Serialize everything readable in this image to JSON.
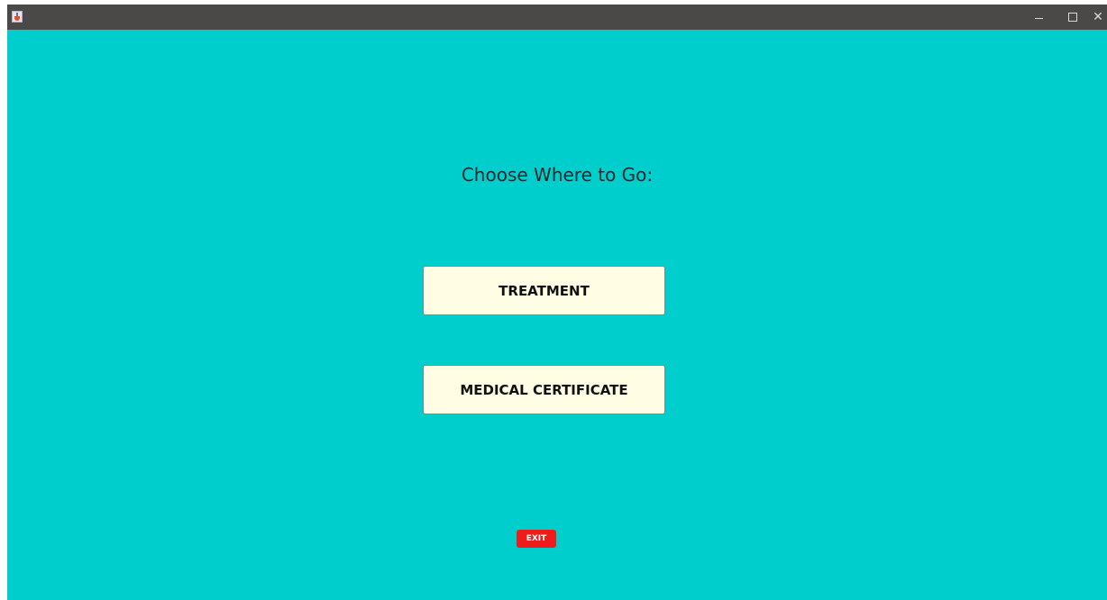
{
  "window": {
    "background_color": "#00cecd",
    "titlebar_color": "#4a4948",
    "icon": "java-app-icon"
  },
  "window_controls": {
    "minimize_glyph": "minimize-icon",
    "maximize_glyph": "maximize-icon",
    "close_glyph": "close-icon"
  },
  "main": {
    "heading": "Choose Where to Go:",
    "buttons": [
      {
        "label": "TREATMENT"
      },
      {
        "label": "MEDICAL CERTIFICATE"
      }
    ],
    "button_color": "#fffde4",
    "exit_label": "EXIT",
    "exit_color": "#f01c1c"
  }
}
